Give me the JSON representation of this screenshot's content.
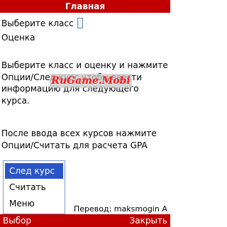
{
  "title": "Главная",
  "form": {
    "class_label": "Выберите класс",
    "grade_label": "Оценка"
  },
  "instructions": {
    "para1": "Выберите класс и оценку и нажмите Опции/След курс,чтобы ввести информацию для следующего курса.",
    "para2": "После ввода всех курсов нажмите Опции/Считать для расчета GPA"
  },
  "watermark": "RuGame.Mobi",
  "menu": {
    "items": [
      {
        "label": "След курс"
      },
      {
        "label": "Считать"
      },
      {
        "label": "Меню"
      }
    ]
  },
  "credit": "Перевод: maksmogin A",
  "softkeys": {
    "left": "Выбор",
    "right": "Закрыть"
  }
}
